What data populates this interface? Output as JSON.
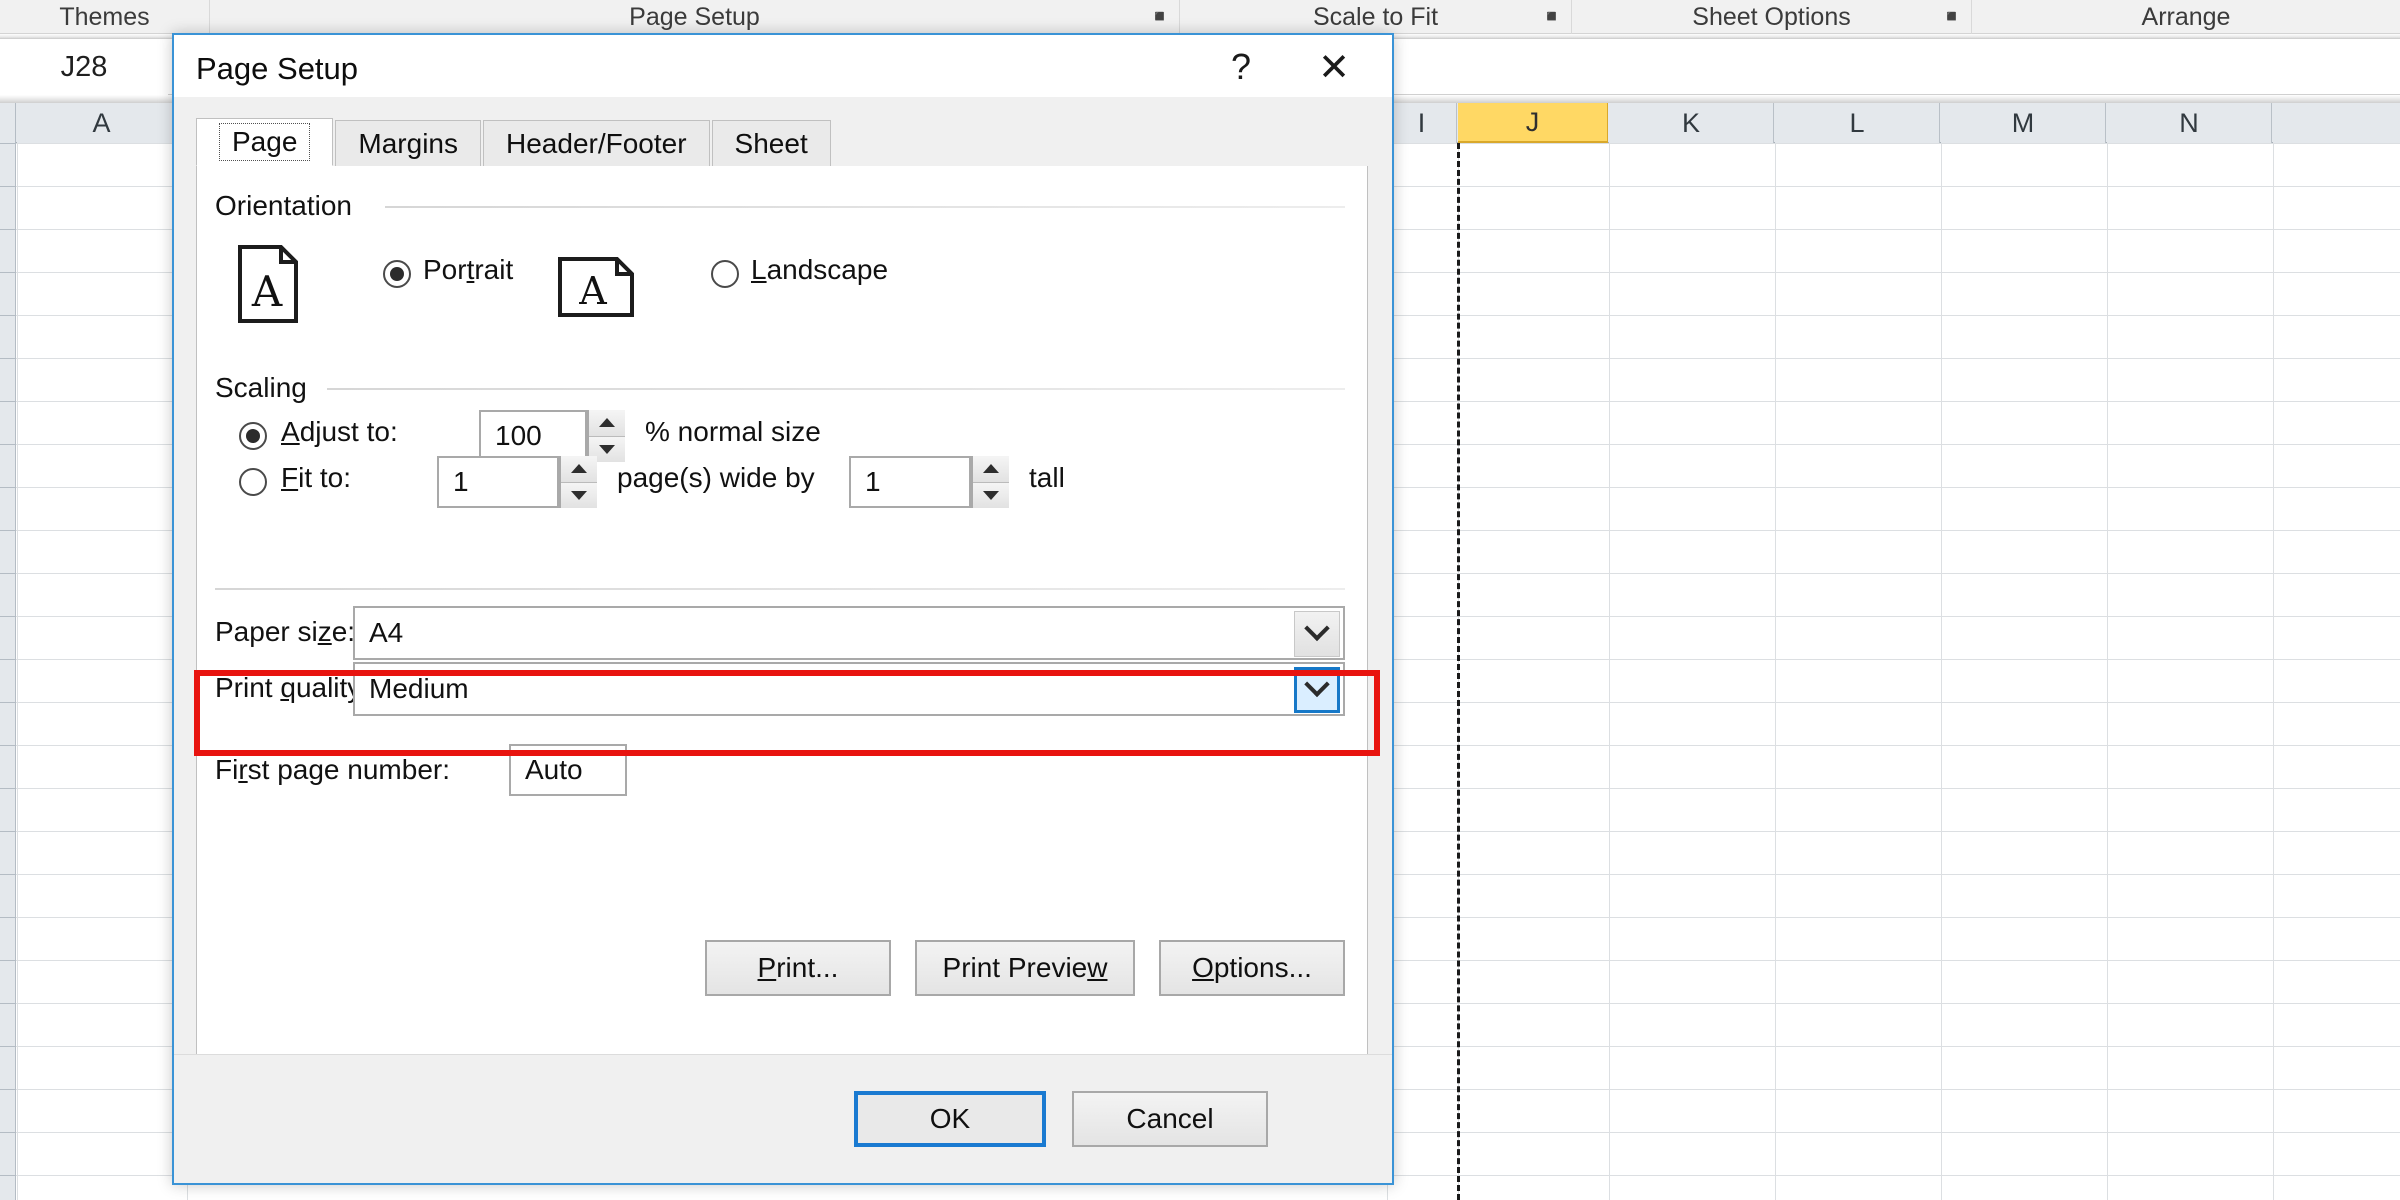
{
  "app": {
    "ribbon_groups": [
      {
        "label": "Themes",
        "launcher": false
      },
      {
        "label": "Page Setup",
        "launcher": true
      },
      {
        "label": "Scale to Fit",
        "launcher": true
      },
      {
        "label": "Sheet Options",
        "launcher": true
      },
      {
        "label": "Arrange",
        "launcher": false
      }
    ],
    "name_box_value": "J28",
    "column_headers": [
      "A",
      "I",
      "J",
      "K",
      "L",
      "M",
      "N"
    ],
    "active_column": "J"
  },
  "dialog": {
    "title": "Page Setup",
    "help_glyph": "?",
    "close_glyph": "✕",
    "tabs": [
      {
        "label": "Page",
        "active": true
      },
      {
        "label": "Margins",
        "active": false
      },
      {
        "label": "Header/Footer",
        "active": false
      },
      {
        "label": "Sheet",
        "active": false
      }
    ],
    "orientation": {
      "group_label": "Orientation",
      "portrait": {
        "label_pre": "Por",
        "label_key": "t",
        "label_post": "rait",
        "selected": true
      },
      "landscape": {
        "label_pre": "",
        "label_key": "L",
        "label_post": "andscape",
        "selected": false
      }
    },
    "scaling": {
      "group_label": "Scaling",
      "adjust_to": {
        "label_pre": "",
        "label_key": "A",
        "label_post": "djust to:",
        "value": "100",
        "suffix": "% normal size",
        "selected": true
      },
      "fit_to": {
        "label_pre": "",
        "label_key": "F",
        "label_post": "it to:",
        "wide_value": "1",
        "middle_label": "page(s) wide by",
        "tall_value": "1",
        "tall_label": "tall",
        "selected": false
      }
    },
    "paper_size": {
      "label_pre": "Paper si",
      "label_key": "z",
      "label_post": "e:",
      "value": "A4",
      "arrow_hover": false
    },
    "print_quality": {
      "label_pre": "Print ",
      "label_key": "q",
      "label_post": "uality:",
      "value": "Medium",
      "arrow_hover": true,
      "highlighted": true
    },
    "first_page_number": {
      "label_pre": "Fi",
      "label_key": "r",
      "label_post": "st page number:",
      "value": "Auto"
    },
    "action_buttons": [
      {
        "label_pre": "",
        "label_key": "P",
        "label_post": "rint...",
        "name": "print-button"
      },
      {
        "label_pre": "Print Previe",
        "label_key": "w",
        "label_post": "",
        "name": "print-preview-button"
      },
      {
        "label_pre": "",
        "label_key": "O",
        "label_post": "ptions...",
        "name": "options-button"
      }
    ],
    "footer_buttons": [
      {
        "label": "OK",
        "default": true,
        "name": "ok-button"
      },
      {
        "label": "Cancel",
        "default": false,
        "name": "cancel-button"
      }
    ]
  },
  "colors": {
    "dialog_border": "#3a93d6",
    "highlight_red": "#e8140f",
    "active_column": "#ffd864",
    "default_button_border": "#1a7ad1",
    "combo_hover": "#1678c8"
  }
}
